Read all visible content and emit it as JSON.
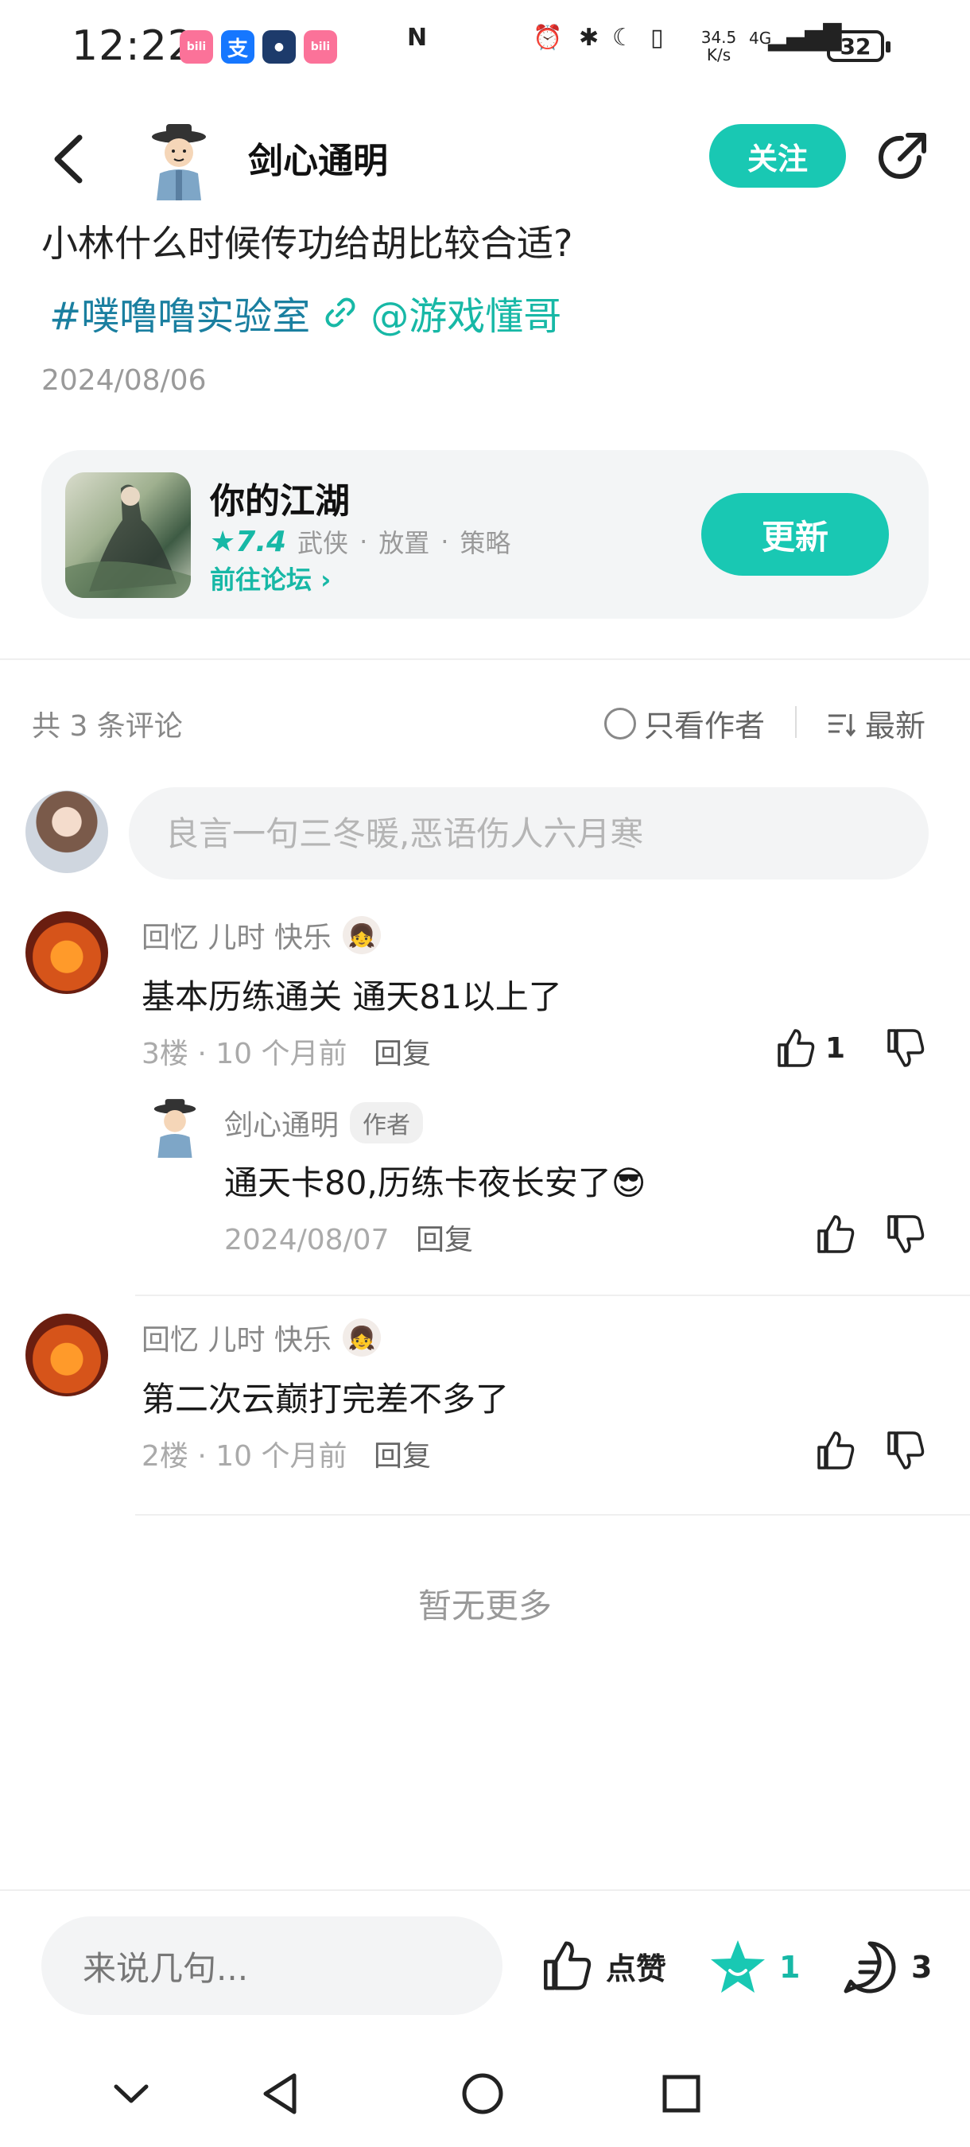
{
  "status_bar": {
    "time": "12:22",
    "app_icons": [
      {
        "name": "bilibili",
        "label": "bili",
        "color": "#fb7299"
      },
      {
        "name": "alipay",
        "label": "支",
        "color": "#1677ff"
      },
      {
        "name": "app-3",
        "label": "",
        "color": "#1d3b6b"
      },
      {
        "name": "bilibili",
        "label": "bili",
        "color": "#fb7299"
      }
    ],
    "speed": "34.5 K/s",
    "network": "4G",
    "battery": "32"
  },
  "header": {
    "author_name": "剑心通明",
    "follow_label": "关注"
  },
  "post": {
    "title": "小林什么时候传功给胡比较合适?",
    "tag": "#噗噜噜实验室",
    "mention": "@游戏懂哥",
    "date": "2024/08/06"
  },
  "game_card": {
    "name": "你的江湖",
    "rating": "★7.4",
    "genres": [
      "武侠",
      "放置",
      "策略"
    ],
    "forum_link": "前往论坛",
    "update_label": "更新"
  },
  "comments_header": {
    "count_text": "共 3 条评论",
    "author_only": "只看作者",
    "sort": "最新"
  },
  "comment_input": {
    "placeholder": "良言一句三冬暖,恶语伤人六月寒"
  },
  "comments": [
    {
      "user": "回忆 儿时 快乐",
      "text": "基本历练通关 通天81以上了",
      "floor": "3楼",
      "time": "10 个月前",
      "reply_label": "回复",
      "likes": "1",
      "replies": [
        {
          "user": "剑心通明",
          "author_tag": "作者",
          "text": "通天卡80,历练卡夜长安了",
          "emoji": "😎",
          "date": "2024/08/07",
          "reply_label": "回复"
        }
      ]
    },
    {
      "user": "回忆 儿时 快乐",
      "text": "第二次云巅打完差不多了",
      "floor": "2楼",
      "time": "10 个月前",
      "reply_label": "回复"
    }
  ],
  "no_more": "暂无更多",
  "bottom_bar": {
    "input_placeholder": "来说几句...",
    "like_label": "点赞",
    "star_count": "1",
    "comment_count": "3"
  },
  "colors": {
    "accent": "#19c8b3",
    "tag": "#1a7fa0"
  }
}
